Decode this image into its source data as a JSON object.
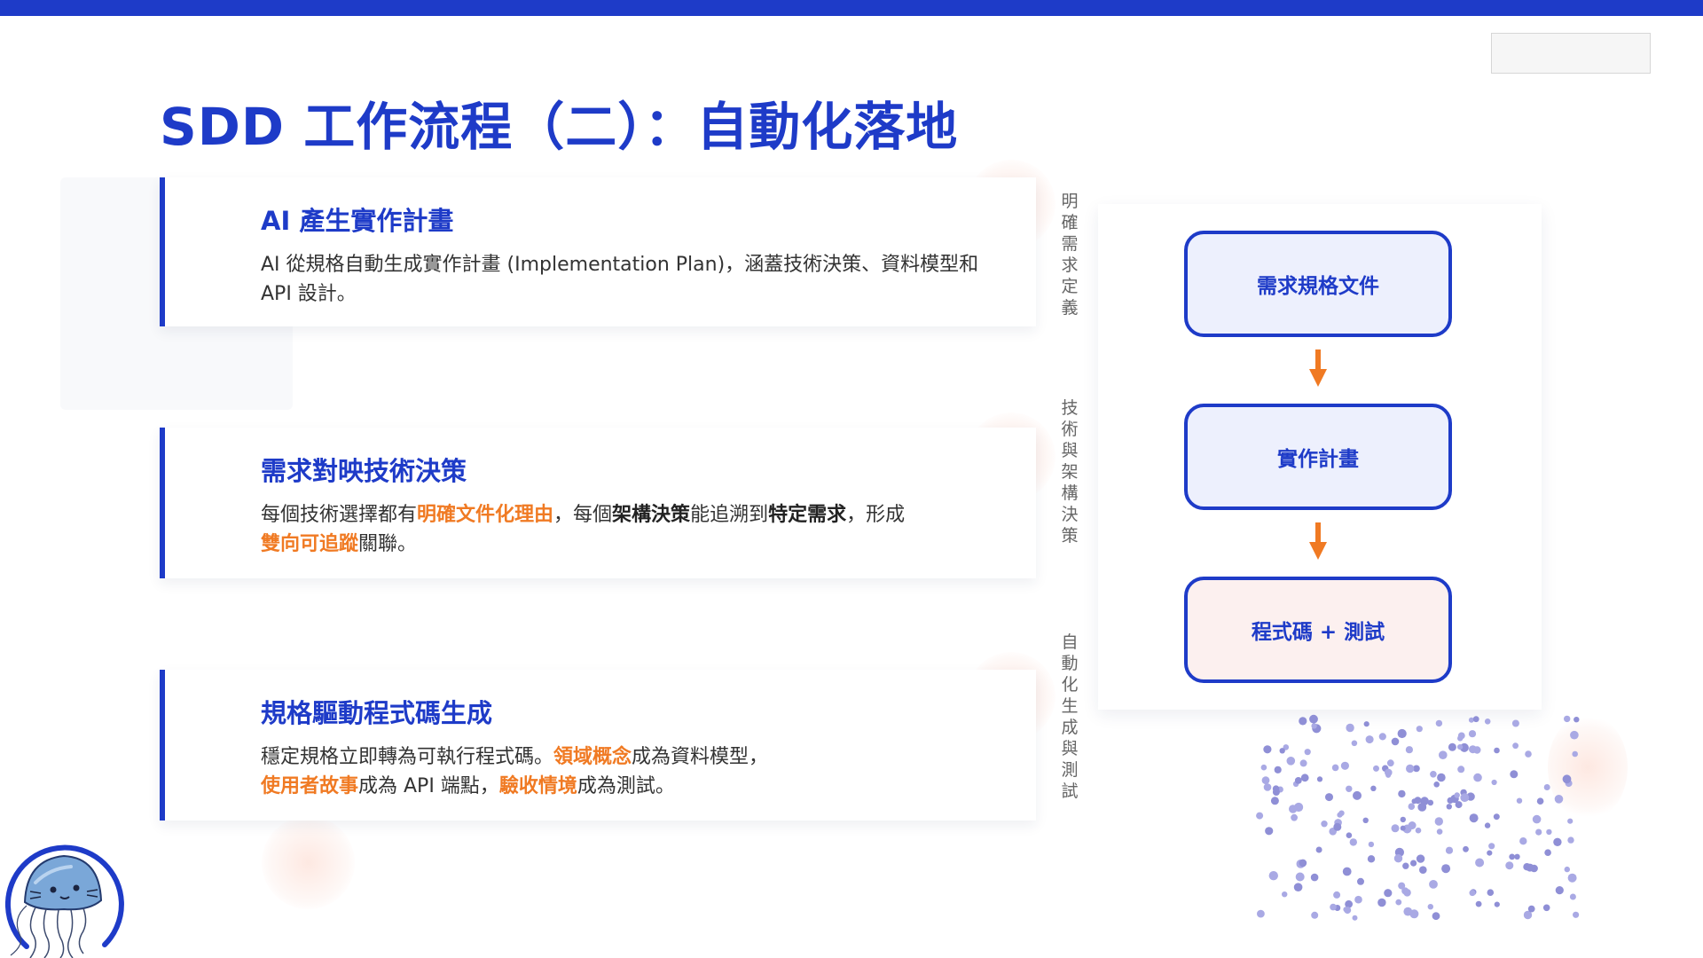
{
  "slide": {
    "title": "SDD 工作流程（二）：自動化落地",
    "accent_color": "#1e3bc8",
    "highlight_color": "#f07a23"
  },
  "cards": [
    {
      "title": "AI 產生實作計畫",
      "body": [
        {
          "text": "AI 從規格自動生成實作計畫 (Implementation Plan)，涵蓋技術決策、資料模型和 API 設計。",
          "style": "normal"
        }
      ]
    },
    {
      "title": "需求對映技術決策",
      "body": [
        {
          "text": "每個技術選擇都有",
          "style": "normal"
        },
        {
          "text": "明確文件化理由",
          "style": "highlight"
        },
        {
          "text": "，每個",
          "style": "normal"
        },
        {
          "text": "架構決策",
          "style": "bold"
        },
        {
          "text": "能追溯到",
          "style": "normal"
        },
        {
          "text": "特定需求",
          "style": "bold"
        },
        {
          "text": "，形成",
          "style": "normal"
        },
        {
          "text": "雙向可追蹤",
          "style": "highlight"
        },
        {
          "text": "關聯。",
          "style": "normal"
        }
      ]
    },
    {
      "title": "規格驅動程式碼生成",
      "body": [
        {
          "text": "穩定規格立即轉為可執行程式碼。",
          "style": "normal"
        },
        {
          "text": "領域概念",
          "style": "highlight"
        },
        {
          "text": "成為資料模型，",
          "style": "normal"
        },
        {
          "text": "使用者故事",
          "style": "highlight"
        },
        {
          "text": "成為 API 端點，",
          "style": "normal"
        },
        {
          "text": "驗收情境",
          "style": "highlight"
        },
        {
          "text": "成為測試。",
          "style": "normal"
        }
      ]
    }
  ],
  "side_labels": [
    "明確需求定義",
    "技術與架構決策",
    "自動化生成與測試"
  ],
  "flow": {
    "nodes": [
      "需求規格文件",
      "實作計畫",
      "程式碼 + 測試"
    ],
    "arrow_icon": "arrow-down-icon"
  },
  "icons": {
    "logo": "jellyfish-logo-icon"
  }
}
